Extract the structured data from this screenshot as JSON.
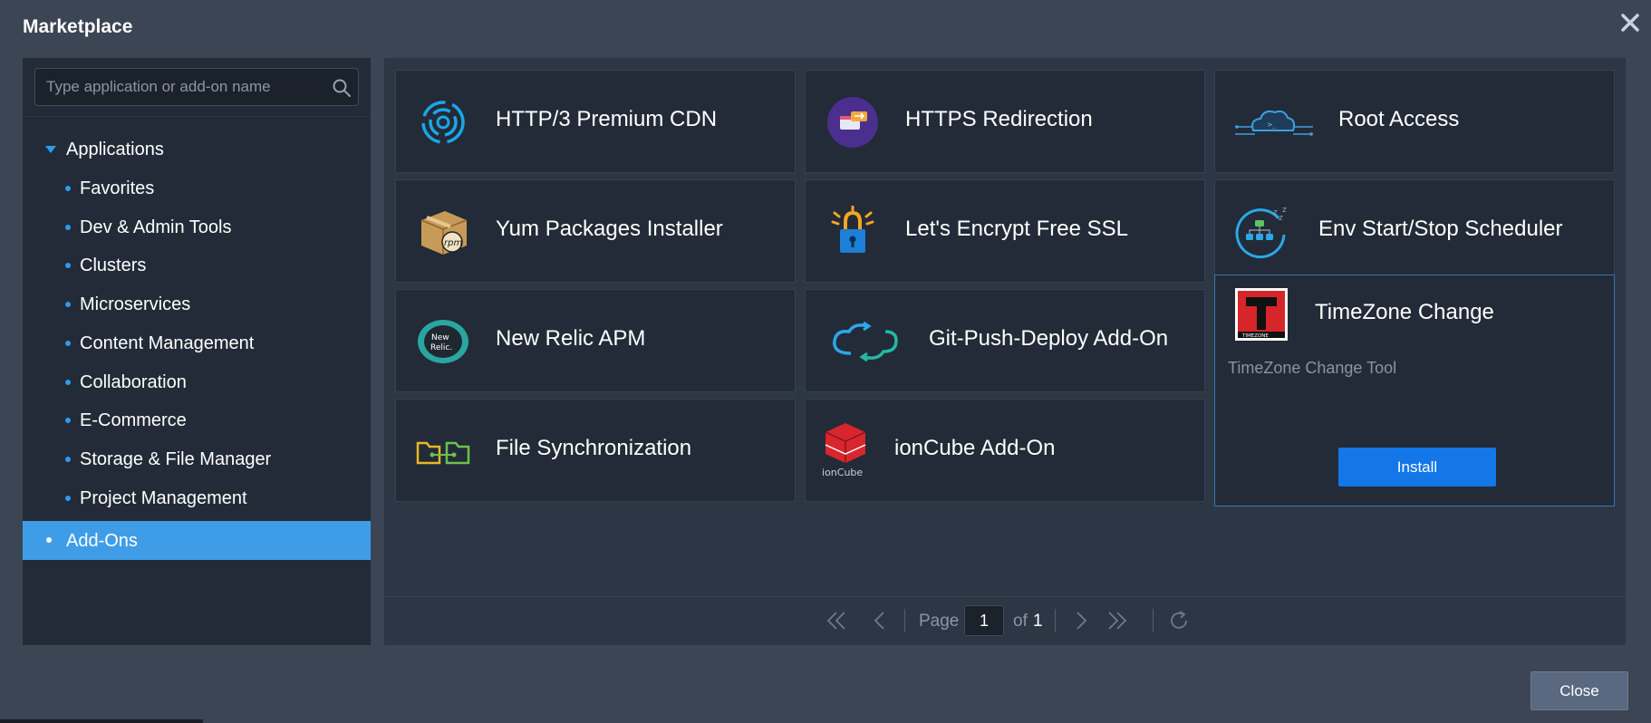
{
  "window": {
    "title": "Marketplace"
  },
  "search": {
    "placeholder": "Type application or add-on name",
    "value": ""
  },
  "sidebar": {
    "root": {
      "label": "Applications"
    },
    "items": [
      {
        "label": "Favorites"
      },
      {
        "label": "Dev & Admin Tools"
      },
      {
        "label": "Clusters"
      },
      {
        "label": "Microservices"
      },
      {
        "label": "Content Management"
      },
      {
        "label": "Collaboration"
      },
      {
        "label": "E-Commerce"
      },
      {
        "label": "Storage & File Manager"
      },
      {
        "label": "Project Management"
      }
    ],
    "active": {
      "label": "Add-Ons"
    }
  },
  "tiles": [
    {
      "title": "HTTP/3 Premium CDN",
      "icon": "cdn-swirl-icon"
    },
    {
      "title": "HTTPS Redirection",
      "icon": "https-redirect-icon"
    },
    {
      "title": "Root Access",
      "icon": "root-access-cloud-icon"
    },
    {
      "title": "Yum Packages Installer",
      "icon": "rpm-box-icon"
    },
    {
      "title": "Let's Encrypt Free SSL",
      "icon": "ssl-lock-icon"
    },
    {
      "title": "Env Start/Stop Scheduler",
      "icon": "scheduler-icon"
    },
    {
      "title": "New Relic APM",
      "icon": "new-relic-icon"
    },
    {
      "title": "Git-Push-Deploy Add-On",
      "icon": "git-deploy-cloud-icon"
    },
    {
      "title": "TimeZone Change",
      "icon": "timezone-logo-icon",
      "description": "TimeZone Change Tool",
      "button": "Install",
      "logo_text": "TIMEZONE"
    },
    {
      "title": "File Synchronization",
      "icon": "file-sync-icon"
    },
    {
      "title": "ionCube Add-On",
      "icon": "ioncube-icon",
      "logo_text": "ionCube"
    }
  ],
  "new_relic_logo_text": "New Relic",
  "rpm_text": "rpm",
  "pager": {
    "page_label": "Page",
    "current_page": "1",
    "of_label": "of",
    "total_pages": "1"
  },
  "footer": {
    "close_label": "Close"
  },
  "colors": {
    "accent": "#3f9de8",
    "install": "#1377e8",
    "background": "#3b4553",
    "panel": "#222b37"
  }
}
